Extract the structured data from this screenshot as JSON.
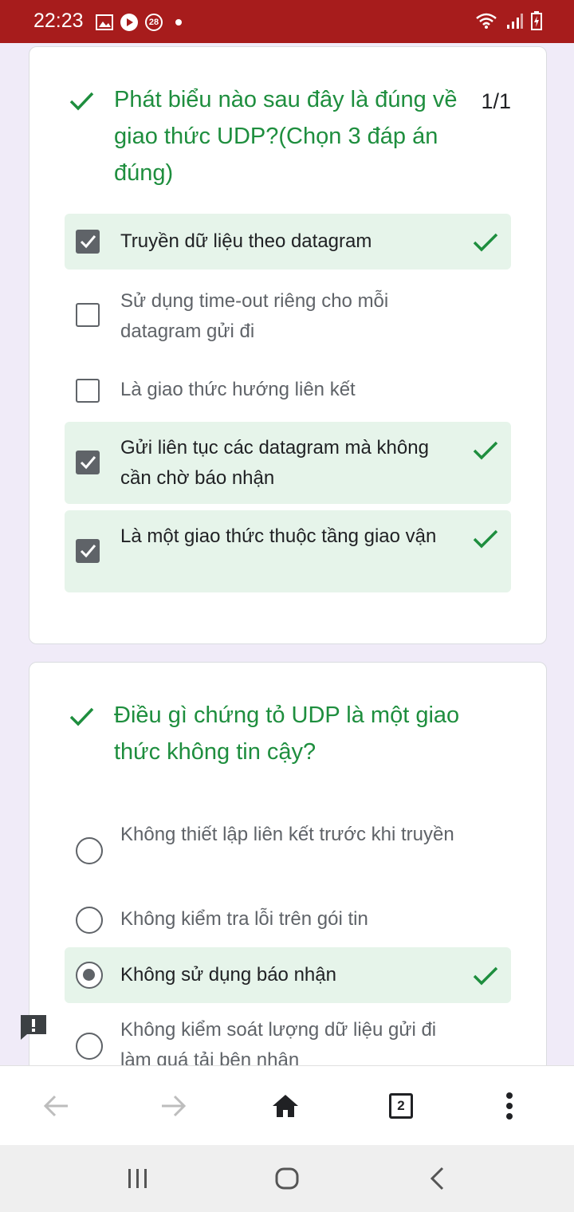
{
  "status": {
    "time": "22:23",
    "notification_count": "28"
  },
  "questions": [
    {
      "title": "Phát biểu nào sau đây là đúng về giao thức UDP?(Chọn 3 đáp án đúng)",
      "score": "1/1",
      "options": [
        {
          "label": "Truyền dữ liệu theo datagram",
          "checked": true,
          "correct": true
        },
        {
          "label": "Sử dụng time-out riêng cho mỗi datagram gửi đi",
          "checked": false,
          "correct": false
        },
        {
          "label": "Là giao thức hướng liên kết",
          "checked": false,
          "correct": false
        },
        {
          "label": "Gửi liên tục các datagram mà không cần chờ báo nhận",
          "checked": true,
          "correct": true
        },
        {
          "label": "Là một giao thức thuộc tầng giao vận",
          "checked": true,
          "correct": true
        }
      ]
    },
    {
      "title": "Điều gì chứng tỏ UDP là một giao thức không tin cậy?",
      "options": [
        {
          "label": "Không thiết lập liên kết trước khi truyền",
          "checked": false,
          "correct": false
        },
        {
          "label": "Không kiểm tra lỗi trên gói tin",
          "checked": false,
          "correct": false
        },
        {
          "label": "Không sử dụng báo nhận",
          "checked": true,
          "correct": true
        },
        {
          "label": "Không kiểm soát lượng dữ liệu gửi đi làm quá tải bên nhận",
          "checked": false,
          "correct": false
        }
      ]
    }
  ],
  "browser": {
    "tab_count": "2"
  },
  "icons": {
    "correct": "check-icon",
    "back": "arrow-left-icon",
    "forward": "arrow-right-icon",
    "home": "home-icon",
    "menu": "more-vert-icon",
    "report": "feedback-icon"
  },
  "colors": {
    "status_bar": "#a71c1c",
    "correct_green": "#1e8e3e",
    "correct_bg": "#e6f4ea"
  }
}
